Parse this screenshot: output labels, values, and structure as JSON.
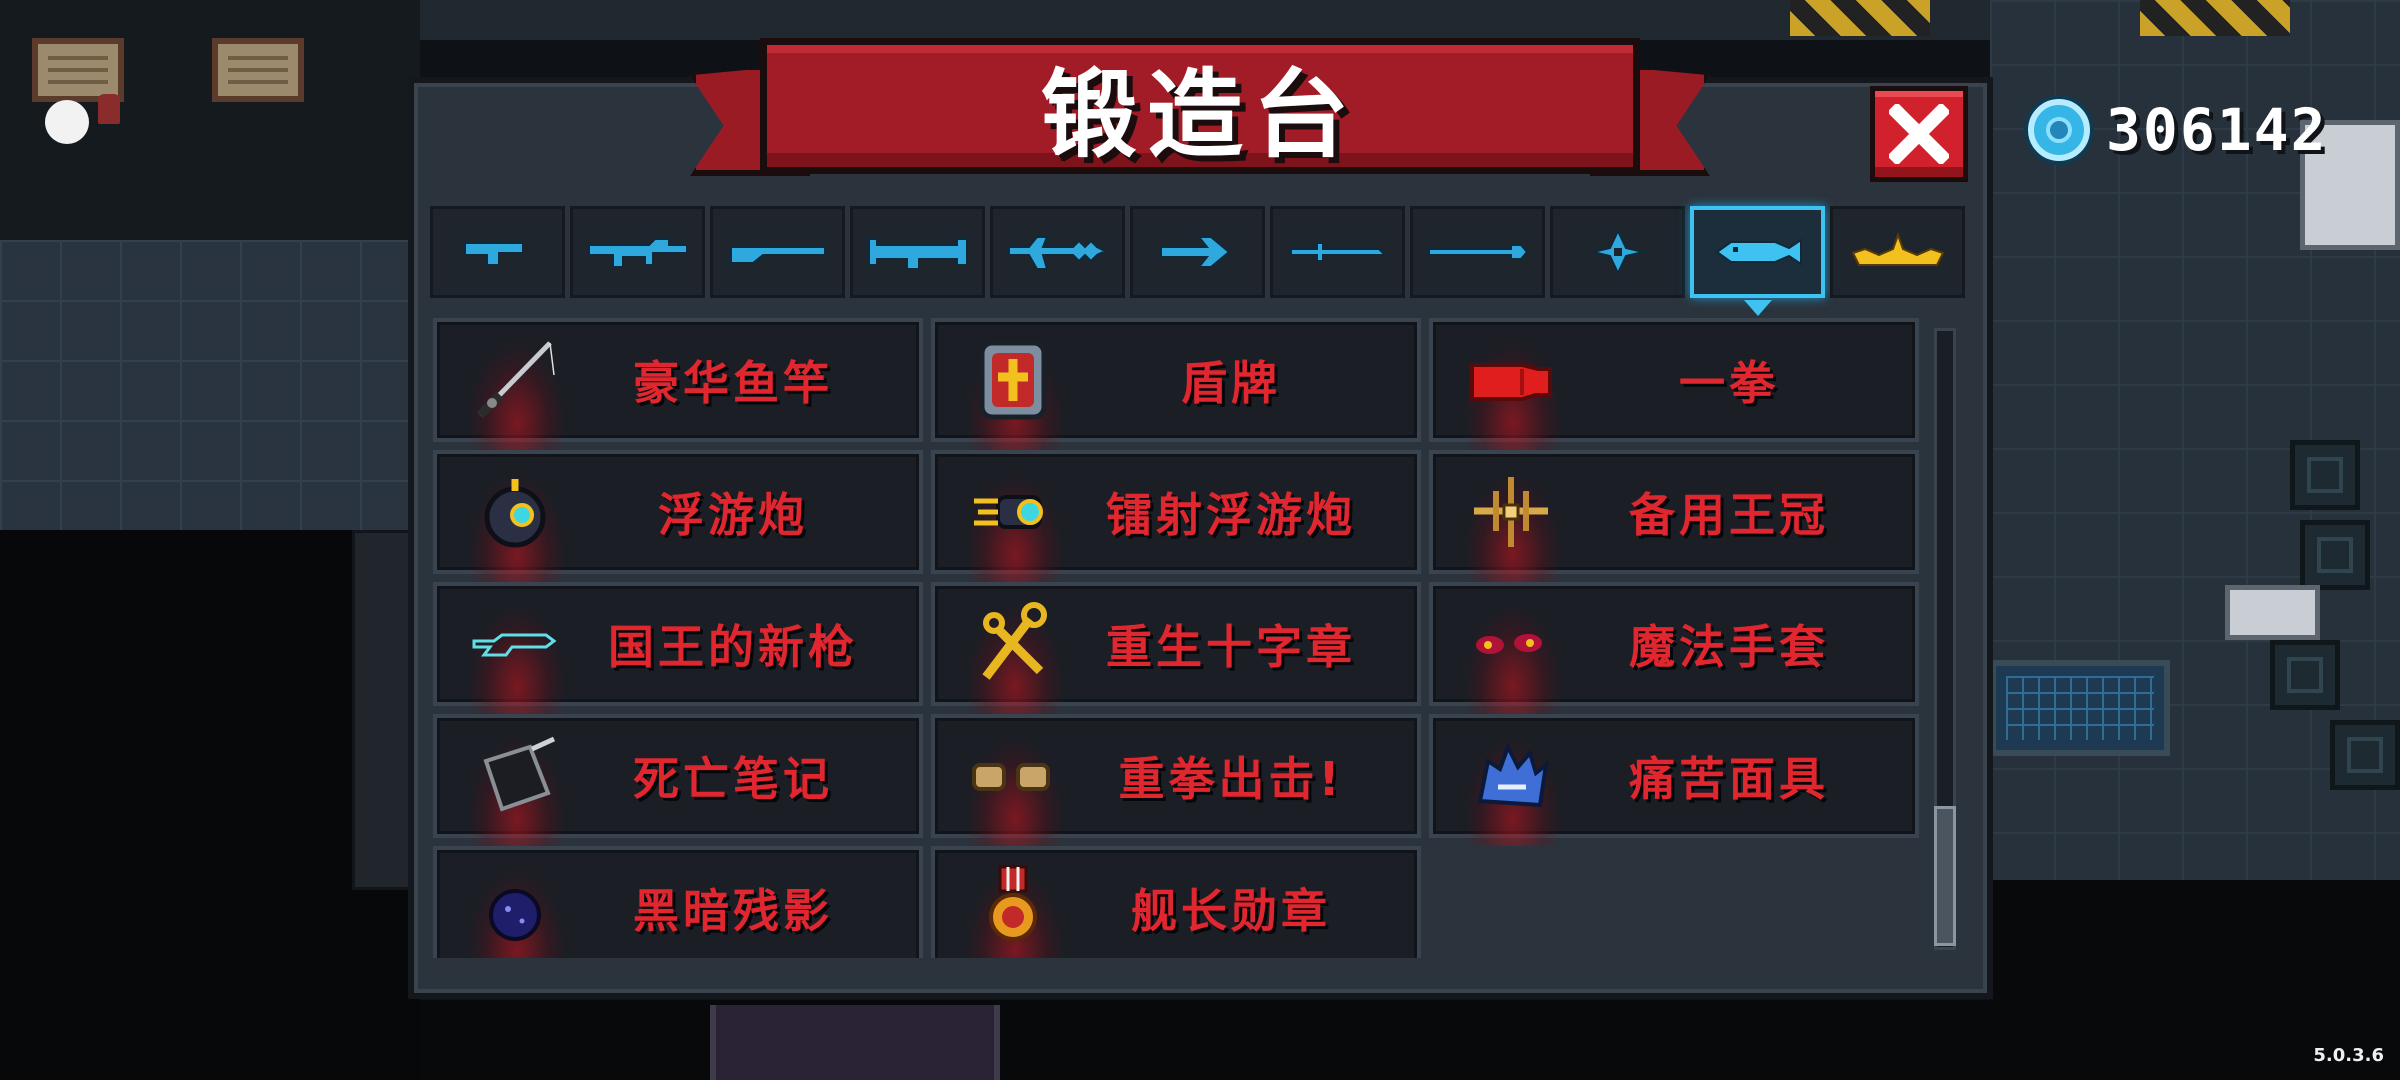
{
  "title": "锻造台",
  "currency": {
    "icon": "gem-icon",
    "amount": "306142"
  },
  "tabs": [
    {
      "icon": "pistol-icon",
      "active": false
    },
    {
      "icon": "assault-rifle-icon",
      "active": false
    },
    {
      "icon": "shotgun-icon",
      "active": false
    },
    {
      "icon": "rocket-launcher-icon",
      "active": false
    },
    {
      "icon": "laser-gun-icon",
      "active": false
    },
    {
      "icon": "bow-icon",
      "active": false
    },
    {
      "icon": "melee-blade-icon",
      "active": false
    },
    {
      "icon": "staff-icon",
      "active": false
    },
    {
      "icon": "shuriken-icon",
      "active": false
    },
    {
      "icon": "fish-icon",
      "active": true
    },
    {
      "icon": "crown-icon",
      "active": false
    }
  ],
  "items": [
    {
      "name": "豪华鱼竿",
      "icon": "fishing-rod-icon"
    },
    {
      "name": "盾牌",
      "icon": "shield-icon"
    },
    {
      "name": "一拳",
      "icon": "red-fist-icon"
    },
    {
      "name": "浮游炮",
      "icon": "floating-cannon-icon"
    },
    {
      "name": "镭射浮游炮",
      "icon": "laser-floating-cannon-icon"
    },
    {
      "name": "备用王冠",
      "icon": "spare-crown-icon"
    },
    {
      "name": "国王的新枪",
      "icon": "kings-new-gun-icon"
    },
    {
      "name": "重生十字章",
      "icon": "rebirth-cross-icon"
    },
    {
      "name": "魔法手套",
      "icon": "magic-gloves-icon"
    },
    {
      "name": "死亡笔记",
      "icon": "death-note-icon"
    },
    {
      "name": "重拳出击!",
      "icon": "power-punch-icon"
    },
    {
      "name": "痛苦面具",
      "icon": "pain-mask-icon"
    },
    {
      "name": "黑暗残影",
      "icon": "dark-shadow-orb-icon"
    },
    {
      "name": "舰长勋章",
      "icon": "captain-medal-icon"
    }
  ],
  "version": "5.0.3.6",
  "colors": {
    "accent": "#3dc2f2",
    "title_banner": "#a11c27",
    "item_text": "#e0262f",
    "close": "#d1212d"
  }
}
